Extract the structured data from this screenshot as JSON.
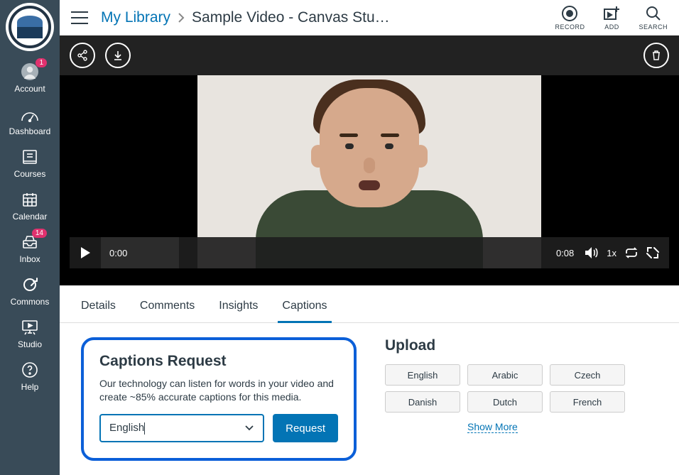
{
  "sidebar": {
    "items": [
      {
        "label": "Account",
        "badge": "1"
      },
      {
        "label": "Dashboard"
      },
      {
        "label": "Courses"
      },
      {
        "label": "Calendar"
      },
      {
        "label": "Inbox",
        "badge": "14"
      },
      {
        "label": "Commons"
      },
      {
        "label": "Studio"
      },
      {
        "label": "Help"
      }
    ]
  },
  "breadcrumb": {
    "library": "My Library",
    "title": "Sample Video - Canvas Stu…"
  },
  "topActions": {
    "record": "RECORD",
    "add": "ADD",
    "search": "SEARCH"
  },
  "player": {
    "current": "0:00",
    "duration": "0:08",
    "speed": "1x"
  },
  "tabs": [
    "Details",
    "Comments",
    "Insights",
    "Captions"
  ],
  "activeTab": 3,
  "request": {
    "heading": "Captions Request",
    "desc": "Our technology can listen for words in your video and create ~85% accurate captions for this media.",
    "selected": "English",
    "button": "Request"
  },
  "upload": {
    "heading": "Upload",
    "langs": [
      "English",
      "Arabic",
      "Czech",
      "Danish",
      "Dutch",
      "French"
    ],
    "showMore": "Show More"
  }
}
